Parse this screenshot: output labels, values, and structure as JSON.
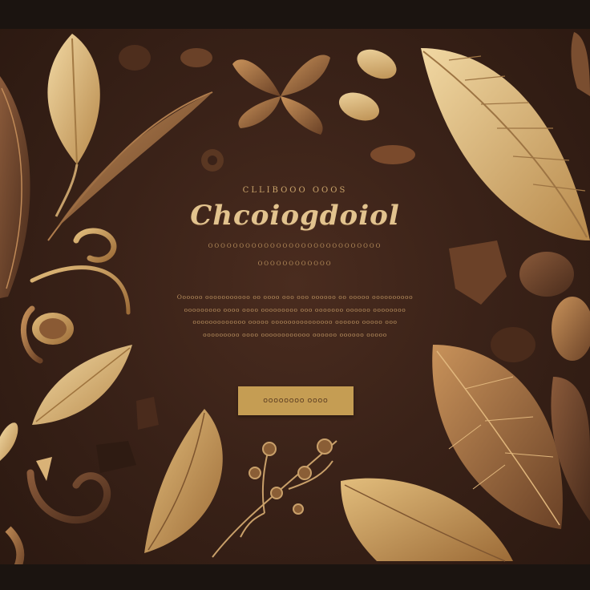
{
  "hero": {
    "eyebrow": "CLLIBOOO OOOS",
    "title": "Chcoiogdoiol",
    "subline": "OOOOOOOOOOOOOOOOOOOOOOOOOOOO",
    "subline2": "OOOOOOOOOOOO",
    "body": "Oooooo ooooooooooo oo oooo ooo ooo oooooo oo ooooo oooooooooo ooooooooo oooo oooo ooooooooo ooo ooooooo oooooo oooooooo ooooooooooooo ooooo ooooooooooooooo oooooo ooooo ooo ooooooooo oooo oooooooooooo oooooo oooooo ooooo"
  },
  "cta": {
    "label": "OOOOOOOO OOOO"
  },
  "colors": {
    "background": "#3a2218",
    "gold": "#c59d53",
    "text": "#b88f5e",
    "title": "#e2c38e"
  },
  "decor": {
    "icons": [
      "leaf-icon",
      "fern-icon",
      "cocoa-bean-icon",
      "chocolate-piece-icon",
      "swirl-icon",
      "flower-icon",
      "truffle-icon",
      "branch-icon"
    ]
  }
}
